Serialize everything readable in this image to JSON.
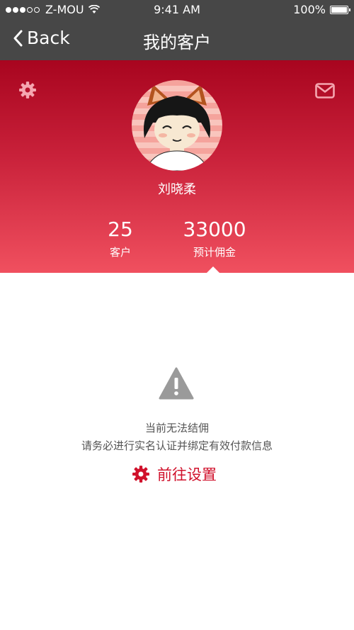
{
  "status_bar": {
    "carrier": "Z-MOU",
    "time": "9:41 AM",
    "battery": "100%",
    "signal_bars_filled": 3,
    "signal_bars_total": 5
  },
  "nav": {
    "back_label": "Back",
    "title": "我的客户"
  },
  "header": {
    "username": "刘晓柔",
    "stats": [
      {
        "value": "25",
        "label": "客户"
      },
      {
        "value": "33000",
        "label": "预计佣金"
      }
    ]
  },
  "empty_state": {
    "line1": "当前无法结佣",
    "line2": "请务必进行实名认证并绑定有效付款信息",
    "action_label": "前往设置"
  },
  "icons": {
    "settings": "gear-icon",
    "messages": "mail-icon",
    "warning": "warning-icon"
  },
  "colors": {
    "nav_bg": "#474747",
    "header_top": "#a8051f",
    "header_bottom": "#f0505f",
    "accent": "#d0112b",
    "muted_text": "#555555"
  }
}
